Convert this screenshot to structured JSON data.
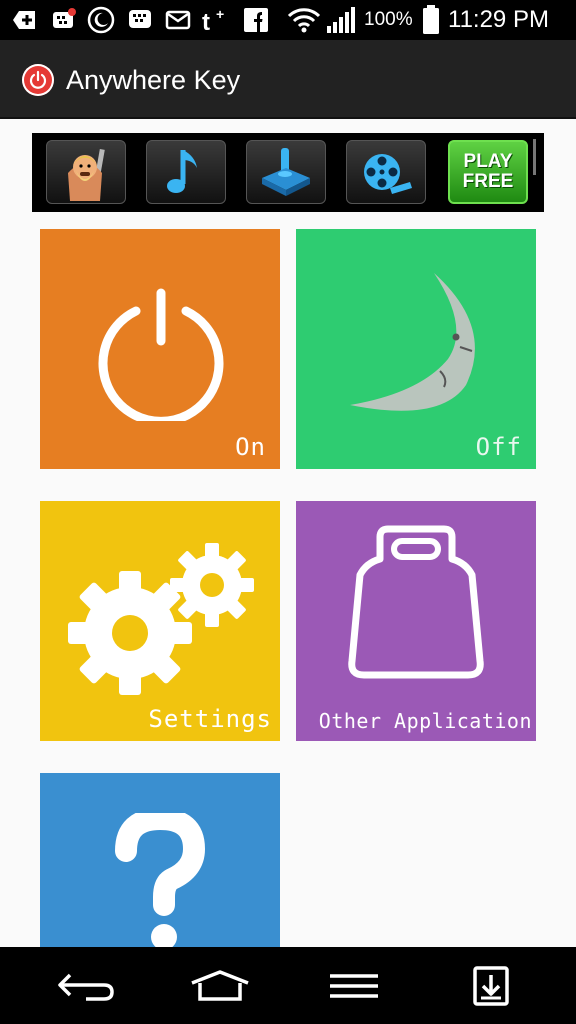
{
  "status_bar": {
    "battery_percent": "100%",
    "time": "11:29 PM",
    "icons": [
      "add-icon",
      "bbm-notification-icon",
      "moon-icon",
      "bbm-icon",
      "mail-icon",
      "tumblr-icon",
      "facebook-icon",
      "wifi-icon",
      "signal-icon",
      "battery-icon"
    ]
  },
  "app_bar": {
    "title": "Anywhere Key",
    "logo_icon": "power-icon"
  },
  "ad_banner": {
    "apps": [
      "clash-of-clans-icon",
      "music-note-icon",
      "joystick-icon",
      "film-reel-icon"
    ],
    "play_label_top": "PLAY",
    "play_label_bottom": "FREE"
  },
  "tiles": [
    {
      "label": "On",
      "icon": "power-icon",
      "color": "#e67e22"
    },
    {
      "label": "Off",
      "icon": "moon-icon",
      "color": "#2ecc71"
    },
    {
      "label": "Settings",
      "icon": "gears-icon",
      "color": "#f1c40f"
    },
    {
      "label": "Other Application",
      "icon": "bag-icon",
      "color": "#9b59b6"
    },
    {
      "label": "",
      "icon": "question-icon",
      "color": "#3a8fd0"
    }
  ],
  "nav_bar": {
    "icons": [
      "back-icon",
      "home-icon",
      "menu-icon",
      "download-icon"
    ]
  },
  "colors": {
    "status_bar": "#000000",
    "app_bar": "#222222",
    "content_bg": "#fafafa"
  }
}
